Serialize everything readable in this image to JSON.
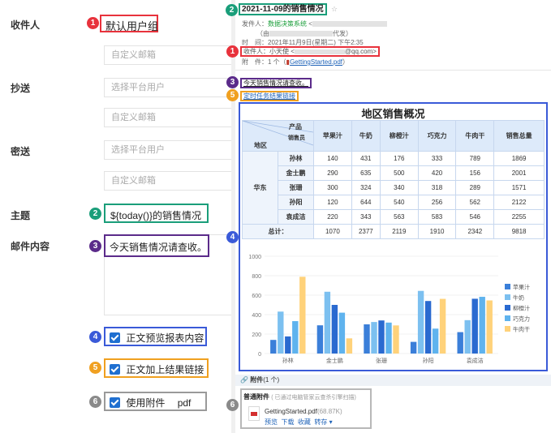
{
  "form": {
    "recipient_label": "收件人",
    "recipient_value": "默认用户组",
    "recipient_email_placeholder": "自定义邮箱",
    "cc_label": "抄送",
    "cc_user_placeholder": "选择平台用户",
    "cc_email_placeholder": "自定义邮箱",
    "bcc_label": "密送",
    "bcc_user_placeholder": "选择平台用户",
    "bcc_email_placeholder": "自定义邮箱",
    "subject_label": "主题",
    "subject_value": "${today()}的销售情况",
    "body_label": "邮件内容",
    "body_value": "今天销售情况请查收。",
    "opt_preview": "正文预览报表内容",
    "opt_link": "正文加上结果链接",
    "opt_attach": "使用附件",
    "opt_attach_type": "pdf"
  },
  "badges": [
    "1",
    "2",
    "3",
    "4",
    "5",
    "6"
  ],
  "email": {
    "subject": "2021-11-09的销售情况",
    "sender_label": "发件人：",
    "sender_name": "数据决策系统",
    "sender_lt": "<",
    "sender_proxy": "（由",
    "sender_proxy2": "代发）",
    "time_label": "时　间：",
    "time_value": "2021年11月9日(星期二) 下午2:35",
    "to_label": "收件人：",
    "to_name": "小天使",
    "to_lt": "<",
    "to_domain": "@qq.com>",
    "att_label": "附　件：",
    "att_count": "1 个",
    "att_file": "GettingStarted.pdf",
    "body_text": "今天销售情况请查收。",
    "link_text": "定时任务结果链接",
    "report_title": "地区销售概况",
    "hdr_product": "产品",
    "hdr_sales": "销售员",
    "hdr_region": "地区",
    "region": "华东",
    "total_label": "总计：",
    "columns": [
      "苹果汁",
      "牛奶",
      "柳橙汁",
      "巧克力",
      "牛肉干",
      "销售总量"
    ],
    "rows": [
      {
        "name": "孙林",
        "vals": [
          "140",
          "431",
          "176",
          "333",
          "789",
          "1869"
        ]
      },
      {
        "name": "金士鹏",
        "vals": [
          "290",
          "635",
          "500",
          "420",
          "156",
          "2001"
        ]
      },
      {
        "name": "张珊",
        "vals": [
          "300",
          "324",
          "340",
          "318",
          "289",
          "1571"
        ]
      },
      {
        "name": "孙阳",
        "vals": [
          "120",
          "644",
          "540",
          "256",
          "562",
          "2122"
        ]
      },
      {
        "name": "袁成洁",
        "vals": [
          "220",
          "343",
          "563",
          "583",
          "546",
          "2255"
        ]
      }
    ],
    "totals": [
      "1070",
      "2377",
      "2119",
      "1910",
      "2342",
      "9818"
    ],
    "attachments_header": "附件",
    "attachments_count": "(1 个)",
    "normal_att": "普通附件",
    "scan_note": "( 已通过电脑管家云查杀引擎扫描)",
    "file_name": "GettingStarted.pdf",
    "file_size": "(68.87K)",
    "actions": [
      "预览",
      "下载",
      "收藏",
      "转存"
    ]
  },
  "chart_data": {
    "type": "bar",
    "categories": [
      "孙林",
      "金士鹏",
      "张珊",
      "孙阳",
      "袁成洁"
    ],
    "series": [
      {
        "name": "苹果汁",
        "values": [
          140,
          290,
          300,
          120,
          220
        ]
      },
      {
        "name": "牛奶",
        "values": [
          431,
          635,
          324,
          644,
          343
        ]
      },
      {
        "name": "柳橙汁",
        "values": [
          176,
          500,
          340,
          540,
          563
        ]
      },
      {
        "name": "巧克力",
        "values": [
          333,
          420,
          318,
          256,
          583
        ]
      },
      {
        "name": "牛肉干",
        "values": [
          789,
          156,
          289,
          562,
          546
        ]
      }
    ],
    "colors": [
      "#3b7fd9",
      "#7cc0f0",
      "#2a6ad0",
      "#5fb3ee",
      "#ffd27a"
    ],
    "ylim": [
      0,
      1000
    ],
    "ticks": [
      "1000",
      "800",
      "600",
      "400",
      "200",
      "0"
    ],
    "legend": "right"
  }
}
